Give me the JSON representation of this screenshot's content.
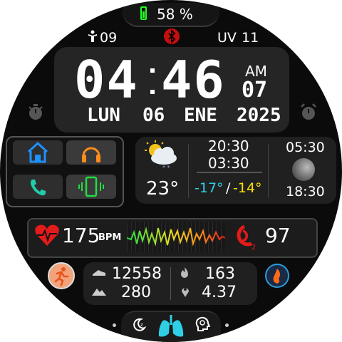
{
  "battery": {
    "percent": "58 %",
    "level": 0.58
  },
  "top": {
    "steps_icon_value": "09",
    "uv_label": "UV",
    "uv_value": "11"
  },
  "time": {
    "hours": "04",
    "minutes": "46",
    "ampm": "AM",
    "seconds": "07"
  },
  "date": {
    "weekday": "LUN",
    "day": "06",
    "month": "ENE",
    "year": "2025"
  },
  "weather": {
    "temp": "23°",
    "time1": "20:30",
    "time2": "03:30",
    "min": "-17°",
    "separator": "/",
    "max": "-14°"
  },
  "moon": {
    "rise": "05:30",
    "set": "18:30"
  },
  "health": {
    "heart_rate": "175",
    "bpm_label": "BPM",
    "spo2": "97"
  },
  "activity": {
    "steps": "12558",
    "calories": "163",
    "floors": "280",
    "distance": "4.37"
  },
  "colors": {
    "accent_blue": "#1e90ff",
    "accent_orange": "#ff8c1a",
    "accent_green": "#22dd44",
    "accent_red": "#e21b1b",
    "cyan": "#2fd0e6",
    "yellow": "#ffe000"
  }
}
